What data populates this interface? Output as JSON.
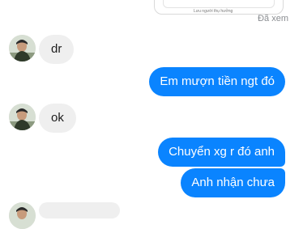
{
  "attachment": {
    "caption": "Lưu người thụ hưởng"
  },
  "status": {
    "seen_label": "Đã xem"
  },
  "messages": [
    {
      "side": "in",
      "text": "dr"
    },
    {
      "side": "out",
      "text": "Em mượn tiền ngt đó"
    },
    {
      "side": "in",
      "text": "ok"
    },
    {
      "side": "out",
      "text": "Chuyển xg r đó anh"
    },
    {
      "side": "out",
      "text": "Anh nhận chưa"
    }
  ],
  "colors": {
    "outgoing_bubble": "#0a84ff",
    "incoming_bubble": "#efefef",
    "seen_text": "#8a8d91"
  },
  "icons": {
    "avatar": "contact-avatar"
  }
}
